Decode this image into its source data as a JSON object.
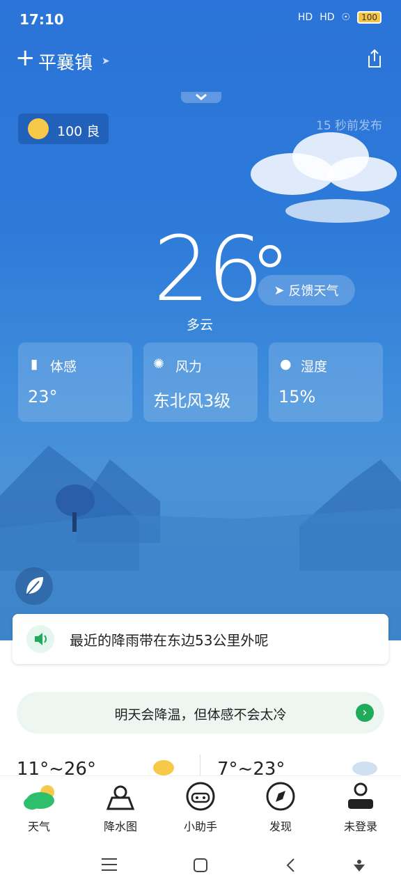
{
  "status_bar": {
    "time": "17:10",
    "signal1": "HD",
    "signal2": "HD",
    "battery": "100"
  },
  "header": {
    "location": "平襄镇"
  },
  "aqi": {
    "value": "100 良"
  },
  "publish_time": "15 秒前发布",
  "current": {
    "temperature": "26",
    "condition": "多云",
    "feedback_label": "反馈天气"
  },
  "cards": [
    {
      "label": "体感",
      "value": "23°"
    },
    {
      "label": "风力",
      "value": "东北风3级"
    },
    {
      "label": "湿度",
      "value": "15%"
    }
  ],
  "notice": {
    "text": "最近的降雨带在东边53公里外呢"
  },
  "tip": {
    "text": "明天会降温，但体感不会太冷"
  },
  "forecast": {
    "today_range": "11°~26°",
    "tomorrow_range": "7°~23°"
  },
  "nav": [
    {
      "label": "天气"
    },
    {
      "label": "降水图"
    },
    {
      "label": "小助手"
    },
    {
      "label": "发现"
    },
    {
      "label": "未登录"
    }
  ],
  "colors": {
    "accent_green": "#1faa5c",
    "sky_blue": "#2b73d8"
  }
}
